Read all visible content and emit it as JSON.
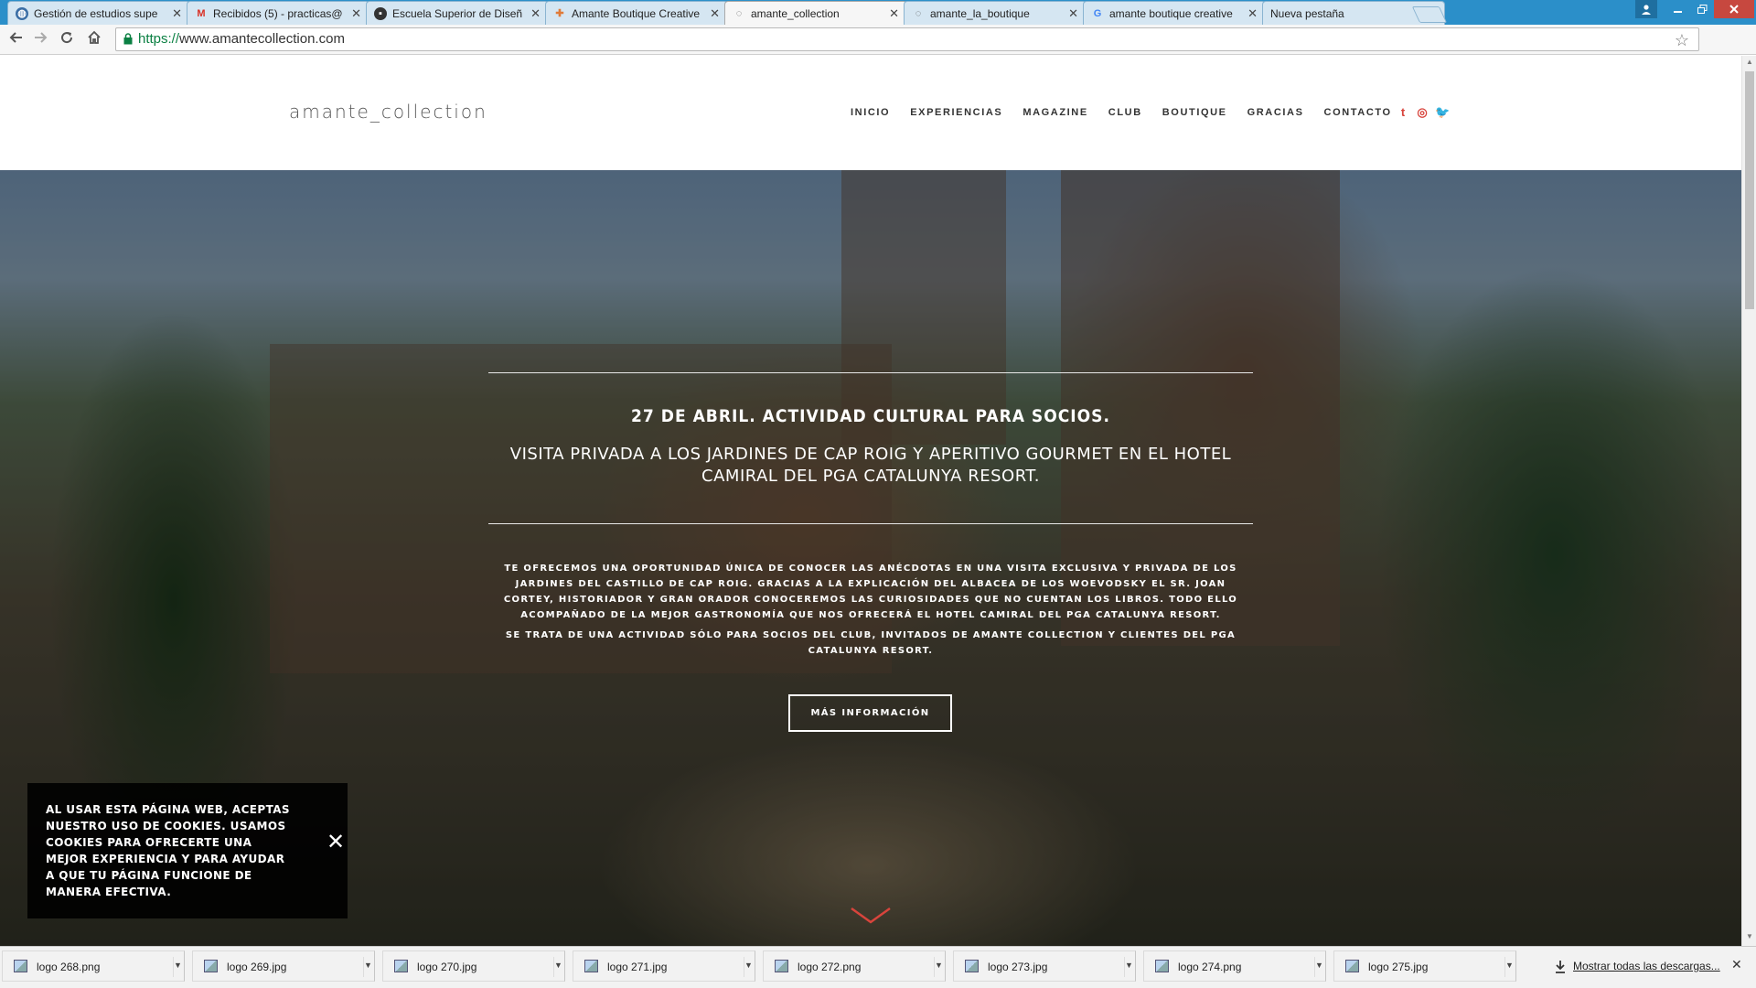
{
  "browser": {
    "tabs": [
      {
        "title": "Gestión de estudios supe",
        "favicon": "globe-icon",
        "active": false
      },
      {
        "title": "Recibidos (5) - practicas@",
        "favicon": "gmail-icon",
        "active": false
      },
      {
        "title": "Escuela Superior de Diseñ",
        "favicon": "chat-icon",
        "active": false
      },
      {
        "title": "Amante Boutique Creative",
        "favicon": "tiles-icon",
        "active": false
      },
      {
        "title": "amante_collection",
        "favicon": "loading-icon",
        "active": true
      },
      {
        "title": "amante_la_boutique",
        "favicon": "loading-icon",
        "active": false
      },
      {
        "title": "amante boutique creative",
        "favicon": "google-icon",
        "active": false
      },
      {
        "title": "Nueva pestaña",
        "favicon": "",
        "active": false
      }
    ],
    "url_protocol": "https://",
    "url_host": "www.amantecollection.com"
  },
  "site": {
    "logo": "amante_collection",
    "nav": [
      "INICIO",
      "EXPERIENCIAS",
      "MAGAZINE",
      "CLUB",
      "BOUTIQUE",
      "GRACIAS",
      "CONTACTO"
    ],
    "social": [
      {
        "name": "tumblr-icon",
        "glyph": "t"
      },
      {
        "name": "instagram-icon",
        "glyph": "◎"
      },
      {
        "name": "twitter-icon",
        "glyph": "🐦"
      }
    ],
    "accent": "#d8443c"
  },
  "hero": {
    "title": "27 DE ABRIL. ACTIVIDAD CULTURAL PARA SOCIOS.",
    "subtitle": "VISITA PRIVADA A LOS JARDINES DE CAP ROIG Y APERITIVO GOURMET EN EL HOTEL CAMIRAL DEL PGA CATALUNYA RESORT.",
    "body1": "TE OFRECEMOS UNA OPORTUNIDAD ÚNICA DE CONOCER LAS ANÉCDOTAS EN UNA VISITA EXCLUSIVA Y PRIVADA DE LOS JARDINES DEL CASTILLO DE CAP ROIG. GRACIAS A LA EXPLICACIÓN DEL ALBACEA DE LOS WOEVODSKY EL SR. JOAN CORTEY, HISTORIADOR Y GRAN ORADOR CONOCEREMOS LAS CURIOSIDADES QUE NO CUENTAN LOS LIBROS. TODO ELLO ACOMPAÑADO DE LA MEJOR GASTRONOMÍA QUE NOS OFRECERÁ EL HOTEL CAMIRAL DEL PGA CATALUNYA RESORT.",
    "body2": "SE TRATA DE UNA ACTIVIDAD SÓLO PARA SOCIOS DEL CLUB, INVITADOS DE AMANTE COLLECTION Y CLIENTES DEL PGA CATALUNYA RESORT.",
    "cta": "MÁS INFORMACIÓN"
  },
  "cookie": {
    "text": "AL USAR ESTA PÁGINA WEB, ACEPTAS NUESTRO USO DE COOKIES. USAMOS COOKIES PARA OFRECERTE UNA MEJOR EXPERIENCIA Y PARA AYUDAR A QUE TU PÁGINA FUNCIONE DE MANERA EFECTIVA.",
    "close": "✕"
  },
  "downloads": {
    "items": [
      "logo 268.png",
      "logo 269.jpg",
      "logo 270.jpg",
      "logo 271.jpg",
      "logo 272.png",
      "logo 273.jpg",
      "logo 274.png",
      "logo 275.jpg"
    ],
    "show_all": "Mostrar todas las descargas..."
  }
}
